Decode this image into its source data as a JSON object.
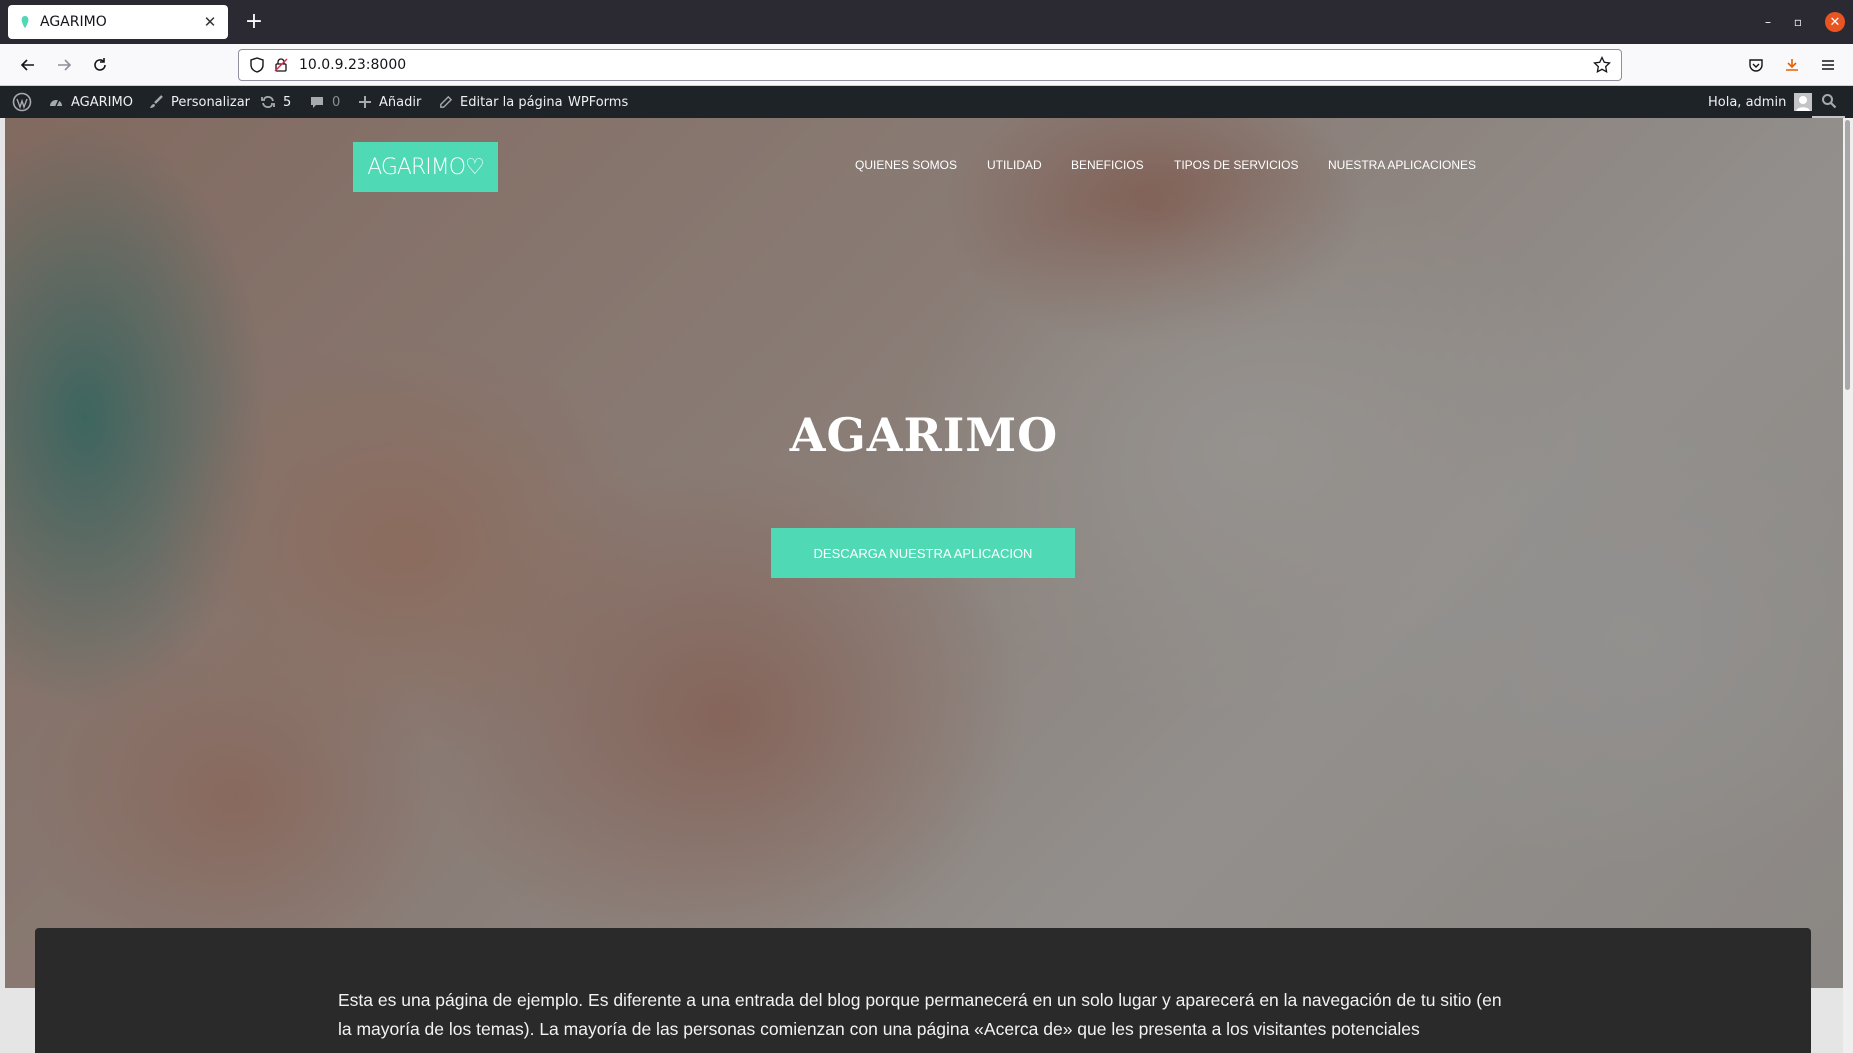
{
  "browser": {
    "tab_title": "AGARIMO",
    "tab_close": "✕",
    "new_tab": "+",
    "url": "10.0.9.23:8000",
    "window_controls": {
      "minimize": "–",
      "maximize": "▫",
      "close": "✕"
    }
  },
  "adminbar": {
    "site_name": "AGARIMO",
    "customize": "Personalizar",
    "updates_count": "5",
    "comments_count": "0",
    "add_new": "Añadir",
    "edit_page": "Editar la página",
    "wpforms": "WPForms",
    "greeting": "Hola, admin"
  },
  "site": {
    "logo_text": "AGARIMO♡",
    "nav": [
      "QUIENES SOMOS",
      "UTILIDAD",
      "BENEFICIOS",
      "TIPOS DE SERVICIOS",
      "NUESTRA APLICACIONES"
    ],
    "hero_title": "AGARIMO",
    "cta_label": "DESCARGA NUESTRA APLICACION",
    "intro_text": "Esta es una página de ejemplo. Es diferente a una entrada del blog porque permanecerá en un solo lugar y aparecerá en la navegación de tu sitio (en la mayoría de los temas). La mayoría de las personas comienzan con una página «Acerca de» que les presenta a los visitantes potenciales"
  },
  "colors": {
    "accent": "#4fd9b5",
    "adminbar_bg": "#1d2327",
    "browser_chrome": "#2b2a33",
    "card_bg": "#2a2a2a"
  }
}
